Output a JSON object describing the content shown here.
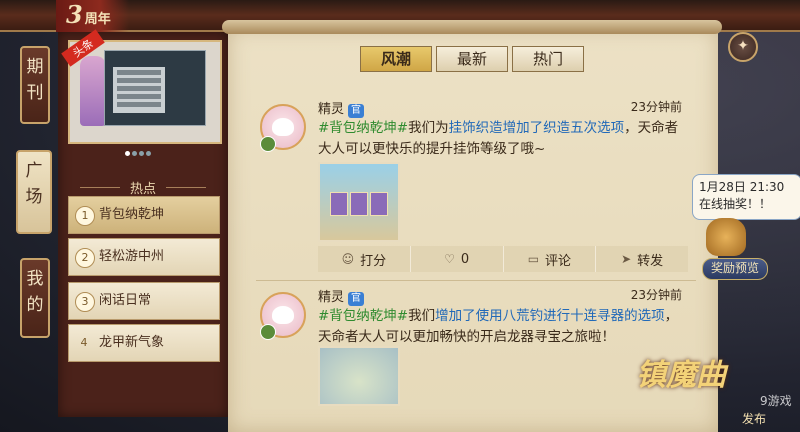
{
  "anniversary": {
    "number": "3",
    "label": "周年"
  },
  "side_tabs": [
    {
      "label": "期刊",
      "active": false
    },
    {
      "label": "广场",
      "active": true
    },
    {
      "label": "我的",
      "active": false
    }
  ],
  "banner": {
    "tag": "头条"
  },
  "hot": {
    "title": "热点",
    "items": [
      {
        "num": "1",
        "label": "背包纳乾坤"
      },
      {
        "num": "2",
        "label": "轻松游中州"
      },
      {
        "num": "3",
        "label": "闲话日常"
      },
      {
        "num": "4",
        "label": "龙甲新气象"
      }
    ]
  },
  "tabs": [
    {
      "label": "风潮",
      "active": true
    },
    {
      "label": "最新",
      "active": false
    },
    {
      "label": "热门",
      "active": false
    }
  ],
  "posts": [
    {
      "author": "精灵",
      "badge": "官",
      "time": "23分钟前",
      "topic": "#背包纳乾坤#",
      "text_pre": "我们为",
      "highlight": "挂饰织造增加了织造五次选项",
      "text_post": "，天命者大人可以更快乐的提升挂饰等级了哦~",
      "actions": {
        "rate": "打分",
        "likes": "0",
        "comment": "评论",
        "share": "转发"
      }
    },
    {
      "author": "精灵",
      "badge": "官",
      "time": "23分钟前",
      "topic": "#背包纳乾坤#",
      "text_pre": "我们",
      "highlight": "增加了使用八荒钓进行十连寻器的选项",
      "text_post": "，天命者大人可以更加畅快的开启龙器寻宝之旅啦！"
    }
  ],
  "reward": {
    "bubble": "1月28日 21:30 在线抽奖！！",
    "button": "奖励预览"
  },
  "logo": {
    "title": "镇魔曲",
    "sub": "发布"
  },
  "watermark": "9游戏"
}
